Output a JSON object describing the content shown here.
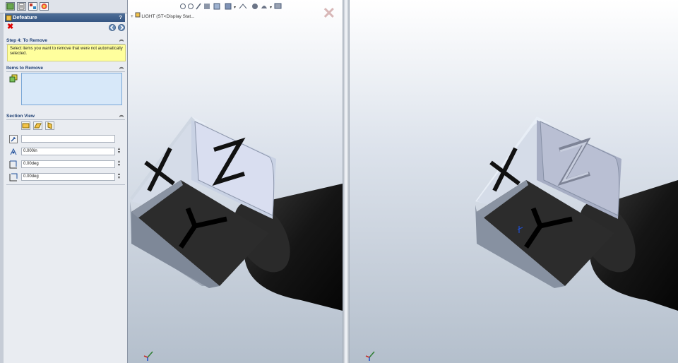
{
  "property_manager": {
    "title": "Defeature",
    "help": "?",
    "step_section": {
      "title": "Step 4: To Remove",
      "message": "Select items you want to remove that were not automatically selected."
    },
    "items_section": {
      "title": "Items to Remove"
    },
    "section_view": {
      "title": "Section View",
      "offset_value": "0.000in",
      "angle1_value": "0.00deg",
      "angle2_value": "0.00deg"
    }
  },
  "viewport_left": {
    "tree_text": "LIGHT (ST<Display Stat..."
  },
  "colors": {
    "title_bar": "#355582",
    "note_bg": "#ffff9d",
    "selection_box": "#d7e8f9"
  }
}
